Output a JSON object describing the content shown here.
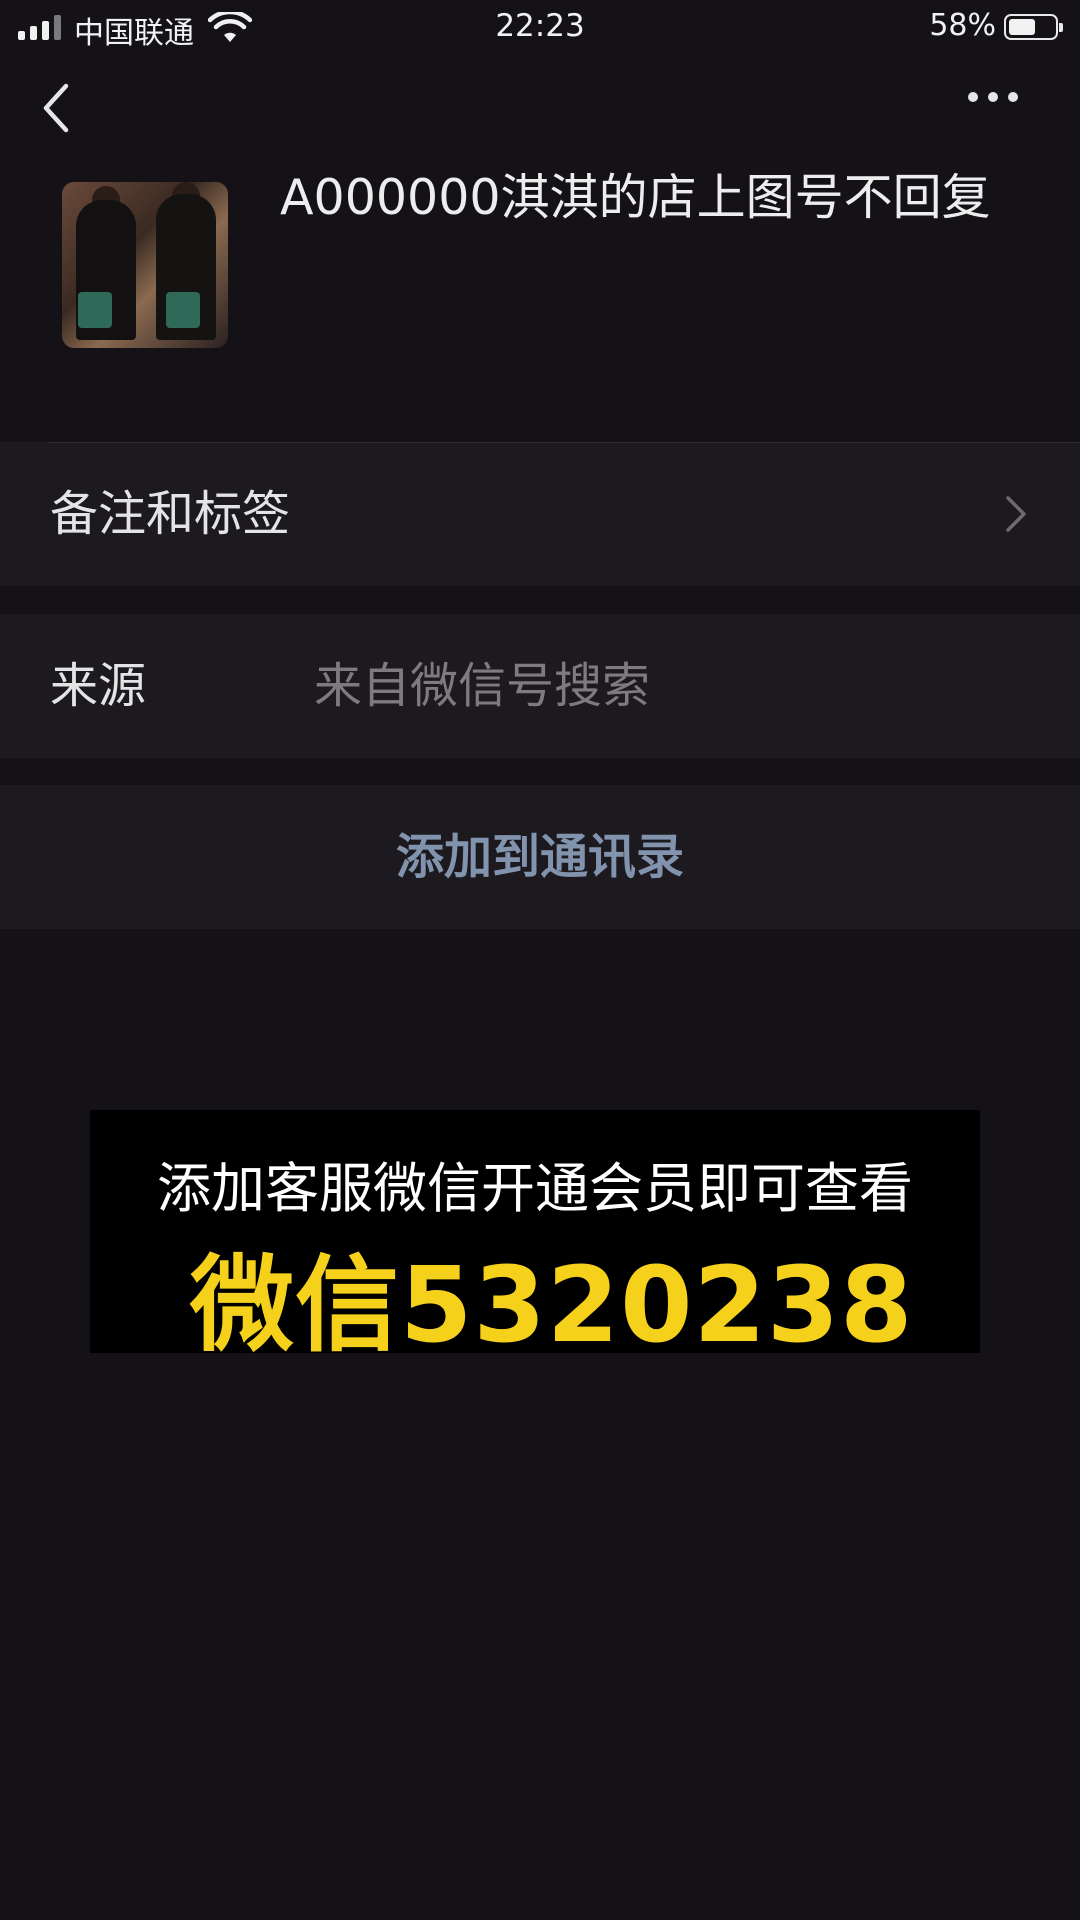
{
  "status_bar": {
    "carrier": "中国联通",
    "time": "22:23",
    "battery_percent_text": "58%",
    "battery_level": 0.58
  },
  "nav": {
    "back_icon": "chevron-left-icon",
    "more_icon": "more-dots-icon"
  },
  "profile": {
    "name": "A000000淇淇的店上图号不回复"
  },
  "rows": {
    "remarks": {
      "label": "备注和标签"
    },
    "source": {
      "label": "来源",
      "value": "来自微信号搜索"
    },
    "add_contact": {
      "label": "添加到通讯录"
    }
  },
  "promo": {
    "line1": "添加客服微信开通会员即可查看",
    "line2": "微信5320238"
  },
  "colors": {
    "background": "#141117",
    "row_bg": "#1c191f",
    "link": "#8193ad",
    "promo_yellow": "#f5d11b"
  }
}
